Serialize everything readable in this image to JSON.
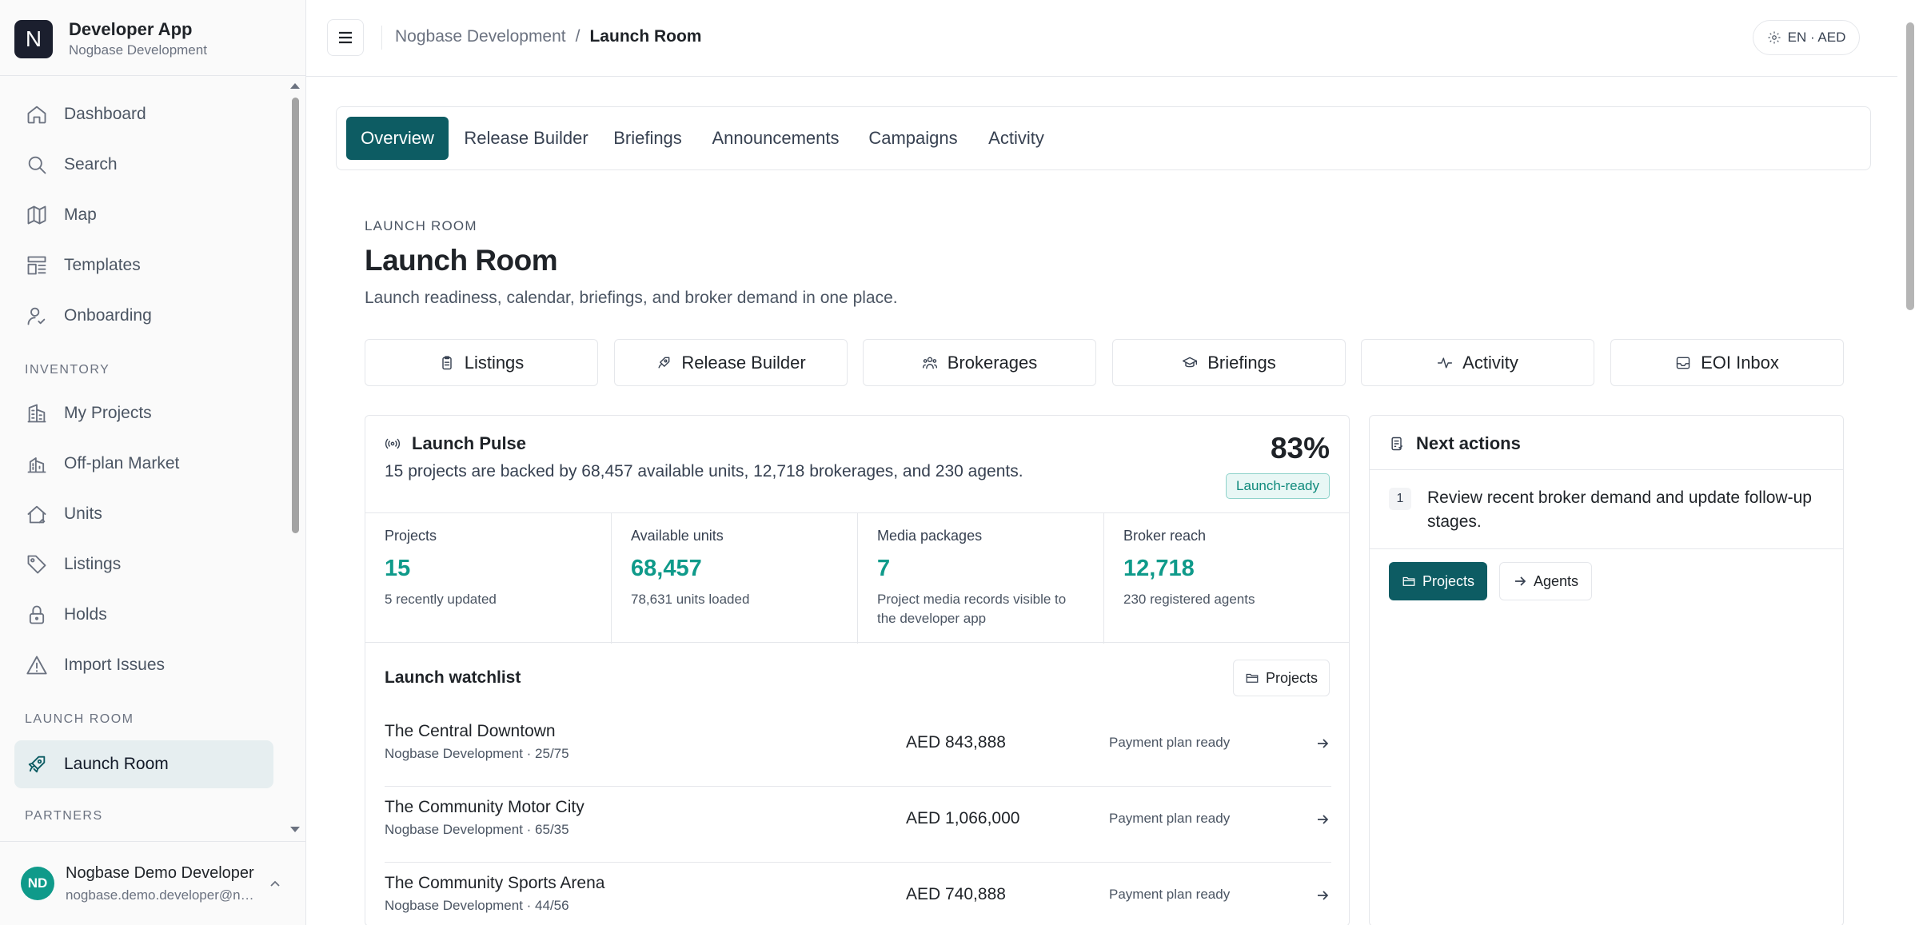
{
  "app": {
    "logo_letter": "N",
    "title": "Developer App",
    "subtitle": "Nogbase Development"
  },
  "sidebar": {
    "items": [
      {
        "label": "Dashboard",
        "icon": "home-icon"
      },
      {
        "label": "Search",
        "icon": "search-icon"
      },
      {
        "label": "Map",
        "icon": "map-icon"
      },
      {
        "label": "Templates",
        "icon": "templates-icon"
      },
      {
        "label": "Onboarding",
        "icon": "user-check-icon"
      }
    ],
    "sections": {
      "inventory": "INVENTORY",
      "launch_room": "LAUNCH ROOM",
      "partners": "PARTNERS"
    },
    "inventory_items": [
      {
        "label": "My Projects",
        "icon": "building-icon"
      },
      {
        "label": "Off-plan Market",
        "icon": "buildings-icon"
      },
      {
        "label": "Units",
        "icon": "house-icon"
      },
      {
        "label": "Listings",
        "icon": "tag-icon"
      },
      {
        "label": "Holds",
        "icon": "lock-icon"
      },
      {
        "label": "Import Issues",
        "icon": "warning-icon"
      }
    ],
    "launch_items": [
      {
        "label": "Launch Room",
        "icon": "rocket-icon",
        "active": true
      }
    ]
  },
  "user": {
    "initials": "ND",
    "name": "Nogbase Demo Developer",
    "email": "nogbase.demo.developer@nogbase.com"
  },
  "topbar": {
    "breadcrumb_parent": "Nogbase Development",
    "breadcrumb_separator": "/",
    "breadcrumb_current": "Launch Room",
    "locale": "EN · AED"
  },
  "tabs": [
    {
      "label": "Overview",
      "active": true
    },
    {
      "label": "Release Builder"
    },
    {
      "label": "Briefings"
    },
    {
      "label": "Announcements"
    },
    {
      "label": "Campaigns"
    },
    {
      "label": "Activity"
    }
  ],
  "header": {
    "eyebrow": "LAUNCH ROOM",
    "title": "Launch Room",
    "description": "Launch readiness, calendar, briefings, and broker demand in one place."
  },
  "quick_links": [
    {
      "label": "Listings",
      "icon": "clipboard-icon"
    },
    {
      "label": "Release Builder",
      "icon": "rocket-icon"
    },
    {
      "label": "Brokerages",
      "icon": "users-icon"
    },
    {
      "label": "Briefings",
      "icon": "graduation-cap-icon"
    },
    {
      "label": "Activity",
      "icon": "pulse-icon"
    },
    {
      "label": "EOI Inbox",
      "icon": "inbox-icon"
    }
  ],
  "pulse": {
    "title": "Launch Pulse",
    "description": "15 projects are backed by 68,457 available units, 12,718 brokerages, and 230 agents.",
    "percent": "83%",
    "badge": "Launch-ready",
    "stats": [
      {
        "label": "Projects",
        "value": "15",
        "note": "5 recently updated"
      },
      {
        "label": "Available units",
        "value": "68,457",
        "note": "78,631 units loaded"
      },
      {
        "label": "Media packages",
        "value": "7",
        "note": "Project media records visible to the developer app"
      },
      {
        "label": "Broker reach",
        "value": "12,718",
        "note": "230 registered agents"
      }
    ],
    "watchlist_title": "Launch watchlist",
    "watchlist_button": "Projects",
    "watchlist": [
      {
        "name": "The Central Downtown",
        "meta": "Nogbase Development · 25/75",
        "price": "AED 843,888",
        "status": "Payment plan ready"
      },
      {
        "name": "The Community Motor City",
        "meta": "Nogbase Development · 65/35",
        "price": "AED 1,066,000",
        "status": "Payment plan ready"
      },
      {
        "name": "The Community Sports Arena",
        "meta": "Nogbase Development · 44/56",
        "price": "AED 740,888",
        "status": "Payment plan ready"
      }
    ]
  },
  "next_actions": {
    "title": "Next actions",
    "items": [
      {
        "num": "1",
        "text": "Review recent broker demand and update follow-up stages."
      }
    ],
    "primary_button": "Projects",
    "secondary_button": "Agents"
  }
}
